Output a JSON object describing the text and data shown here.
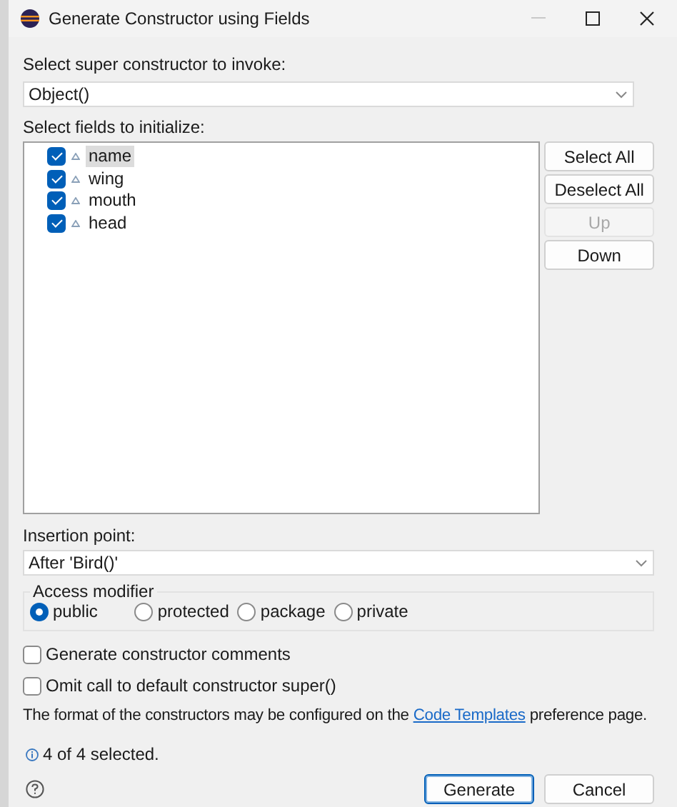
{
  "window": {
    "title": "Generate Constructor using Fields"
  },
  "super_constructor": {
    "label": "Select super constructor to invoke:",
    "value": "Object()"
  },
  "fields": {
    "label": "Select fields to initialize:",
    "items": [
      {
        "name": "name",
        "checked": true,
        "selected": true
      },
      {
        "name": "wing",
        "checked": true,
        "selected": false
      },
      {
        "name": "mouth",
        "checked": true,
        "selected": false
      },
      {
        "name": "head",
        "checked": true,
        "selected": false
      }
    ]
  },
  "side_buttons": [
    {
      "label": "Select All",
      "disabled": false
    },
    {
      "label": "Deselect All",
      "disabled": false
    },
    {
      "label": "Up",
      "disabled": true
    },
    {
      "label": "Down",
      "disabled": false
    }
  ],
  "insertion_point": {
    "label": "Insertion point:",
    "value": "After 'Bird()'"
  },
  "access_modifier": {
    "label": "Access modifier",
    "options": [
      {
        "label": "public",
        "selected": true
      },
      {
        "label": "protected",
        "selected": false
      },
      {
        "label": "package",
        "selected": false
      },
      {
        "label": "private",
        "selected": false
      }
    ]
  },
  "options": [
    {
      "label": "Generate constructor comments",
      "checked": false
    },
    {
      "label": "Omit call to default constructor super()",
      "checked": false
    }
  ],
  "note": {
    "before": "The format of the constructors may be configured on the ",
    "link": "Code Templates",
    "after": " preference page."
  },
  "status": "4 of 4 selected.",
  "buttons": [
    {
      "label": "Generate",
      "default": true
    },
    {
      "label": "Cancel",
      "default": false
    }
  ]
}
